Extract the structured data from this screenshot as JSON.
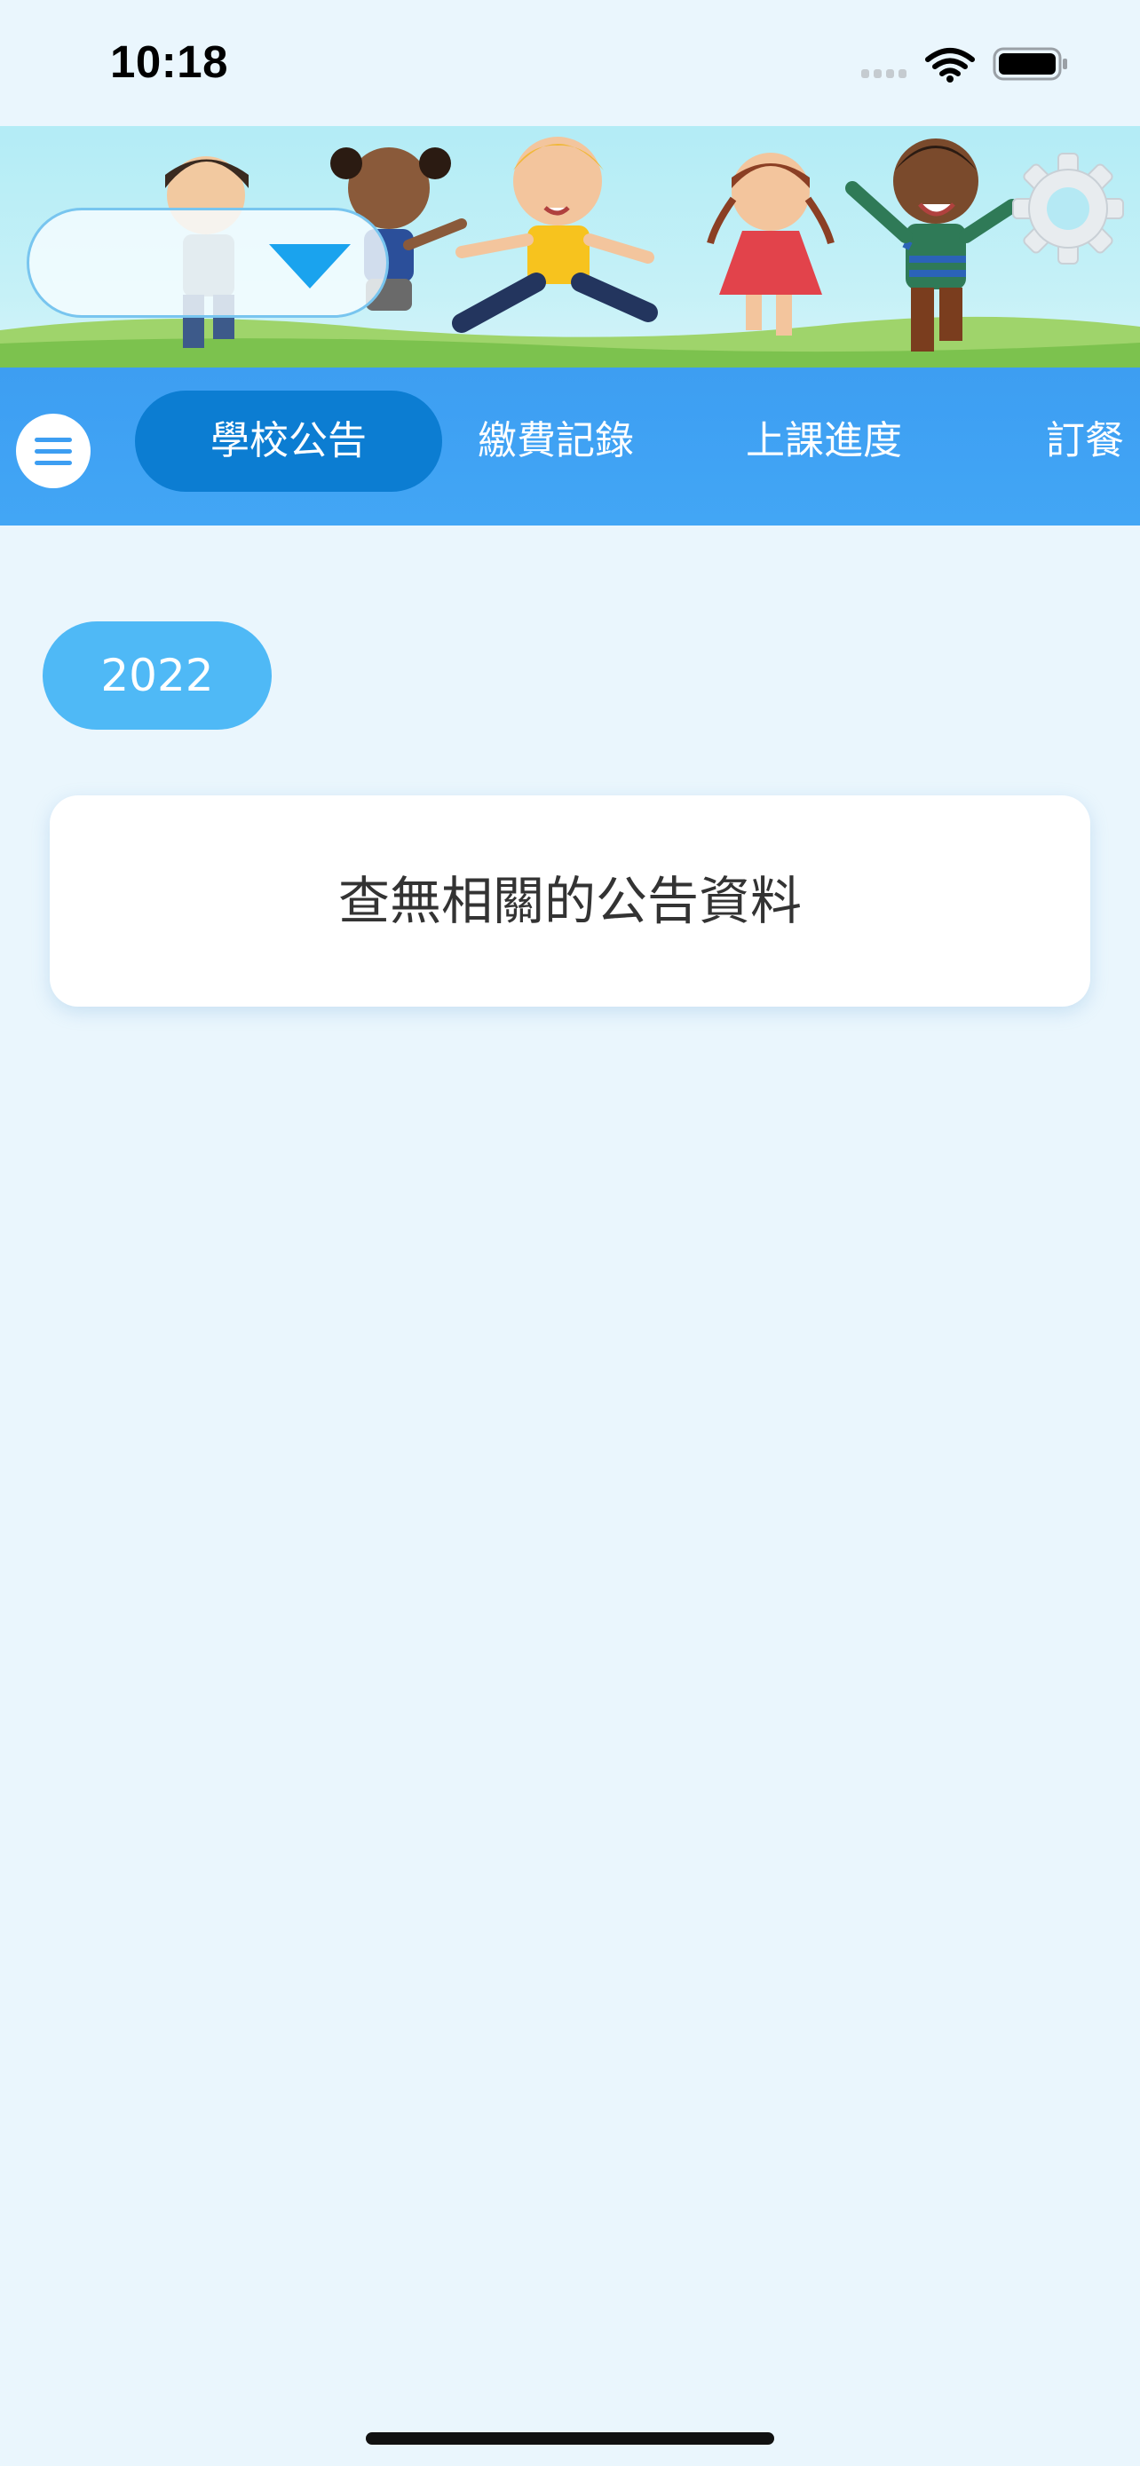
{
  "status_bar": {
    "time": "10:18"
  },
  "header": {
    "settings_icon": "gear-icon",
    "menu_icon": "hamburger-menu-icon",
    "selector_icon": "triangle-down-icon"
  },
  "tabs": [
    {
      "label": "學校公告",
      "active": true
    },
    {
      "label": "繳費記錄",
      "active": false
    },
    {
      "label": "上課進度",
      "active": false
    },
    {
      "label": "訂餐",
      "active": false
    }
  ],
  "content": {
    "year": "2022",
    "empty_message": "查無相關的公告資料"
  },
  "colors": {
    "background": "#eaf6fd",
    "nav": "#3d9ef2",
    "active_tab": "#0c7dd2",
    "year_chip": "#4fb9f6"
  }
}
